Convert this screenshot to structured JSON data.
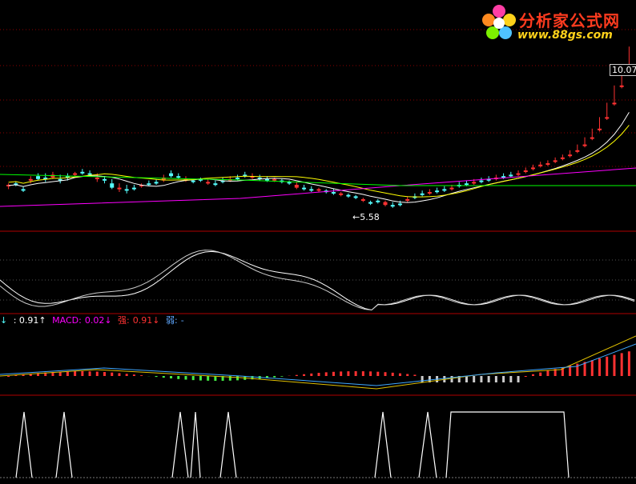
{
  "watermark": {
    "title": "分析家公式网",
    "url": "www.88gs.com"
  },
  "price": {
    "high_label": "10.07",
    "low_label": "5.58"
  },
  "indicator_bar": {
    "item1": "↓",
    "item2": ": 0.91↑",
    "macd_label": "MACD:",
    "macd_value": "0.02↓",
    "strong_label": "强:",
    "strong_value": "0.91↓",
    "weak_label": "弱:",
    "weak_value": "-"
  },
  "colors": {
    "up": "#ff3232",
    "down": "#54fcfc",
    "ma1": "#ffffff",
    "ma2": "#ffff00",
    "ma3": "#ff00ff",
    "ma4": "#00ff00",
    "grid": "#8b0000"
  },
  "chart_data": {
    "type": "candlestick",
    "panels": [
      "price",
      "oscillator",
      "macd",
      "signal"
    ],
    "price_candles": [
      [
        0.5,
        0.6,
        0.4,
        0.2
      ],
      [
        0.6,
        0.7,
        0.5,
        0.4
      ],
      [
        0.2,
        0.4,
        0.1,
        0.0
      ],
      [
        0.9,
        1.1,
        0.8,
        0.6
      ],
      [
        1.1,
        1.3,
        0.9,
        0.8
      ],
      [
        1.0,
        1.3,
        0.9,
        0.7
      ],
      [
        1.2,
        1.4,
        1.0,
        0.9
      ],
      [
        0.9,
        1.2,
        0.8,
        0.6
      ],
      [
        1.1,
        1.3,
        1.0,
        0.8
      ],
      [
        1.3,
        1.4,
        1.2,
        1.1
      ],
      [
        1.4,
        1.6,
        1.3,
        1.2
      ],
      [
        1.3,
        1.5,
        1.2,
        1.1
      ],
      [
        1.0,
        1.3,
        0.9,
        0.7
      ],
      [
        0.9,
        1.1,
        0.8,
        0.6
      ],
      [
        0.6,
        0.9,
        0.3,
        0.2
      ],
      [
        0.3,
        0.6,
        0.2,
        0.0
      ],
      [
        0.2,
        0.5,
        0.1,
        -0.1
      ],
      [
        0.3,
        0.5,
        0.2,
        0.1
      ],
      [
        0.5,
        0.6,
        0.4,
        0.3
      ],
      [
        0.6,
        0.8,
        0.5,
        0.4
      ],
      [
        0.7,
        0.9,
        0.6,
        0.5
      ],
      [
        1.0,
        1.2,
        0.8,
        0.7
      ],
      [
        1.3,
        1.5,
        1.1,
        1.0
      ],
      [
        1.1,
        1.3,
        1.0,
        0.9
      ],
      [
        0.9,
        1.1,
        0.8,
        0.7
      ],
      [
        0.8,
        0.9,
        0.7,
        0.6
      ],
      [
        0.9,
        1.0,
        0.8,
        0.7
      ],
      [
        0.7,
        0.9,
        0.6,
        0.5
      ],
      [
        0.6,
        0.8,
        0.5,
        0.4
      ],
      [
        0.8,
        1.0,
        0.7,
        0.6
      ],
      [
        0.9,
        1.1,
        0.8,
        0.7
      ],
      [
        1.0,
        1.2,
        0.9,
        0.8
      ],
      [
        1.2,
        1.4,
        1.1,
        1.0
      ],
      [
        1.1,
        1.3,
        1.0,
        0.9
      ],
      [
        1.0,
        1.2,
        0.9,
        0.8
      ],
      [
        0.9,
        1.1,
        0.8,
        0.7
      ],
      [
        0.9,
        1.0,
        0.8,
        0.7
      ],
      [
        0.8,
        0.9,
        0.7,
        0.6
      ],
      [
        0.7,
        0.8,
        0.6,
        0.5
      ],
      [
        0.5,
        0.7,
        0.3,
        0.2
      ],
      [
        0.3,
        0.5,
        0.2,
        0.1
      ],
      [
        0.2,
        0.4,
        0.1,
        0.0
      ],
      [
        0.2,
        0.3,
        0.1,
        0.0
      ],
      [
        0.1,
        0.2,
        0.0,
        -0.1
      ],
      [
        0.0,
        0.2,
        -0.1,
        -0.2
      ],
      [
        -0.1,
        0.0,
        -0.2,
        -0.3
      ],
      [
        -0.2,
        -0.1,
        -0.3,
        -0.4
      ],
      [
        -0.3,
        -0.2,
        -0.4,
        -0.5
      ],
      [
        -0.5,
        -0.4,
        -0.6,
        -0.7
      ],
      [
        -0.7,
        -0.6,
        -0.8,
        -0.9
      ],
      [
        -0.6,
        -0.5,
        -0.7,
        -0.8
      ],
      [
        -0.7,
        -0.6,
        -0.9,
        -1.0
      ],
      [
        -0.9,
        -0.7,
        -1.0,
        -1.1
      ],
      [
        -0.8,
        -0.6,
        -0.9,
        -1.0
      ],
      [
        -0.5,
        -0.3,
        -0.6,
        -0.7
      ],
      [
        -0.3,
        -0.1,
        -0.4,
        -0.5
      ],
      [
        -0.1,
        0.1,
        -0.2,
        -0.3
      ],
      [
        0.0,
        0.2,
        -0.1,
        -0.2
      ],
      [
        0.1,
        0.3,
        0.0,
        -0.1
      ],
      [
        0.2,
        0.4,
        0.1,
        0.0
      ],
      [
        0.3,
        0.5,
        0.2,
        0.1
      ],
      [
        0.5,
        0.7,
        0.4,
        0.3
      ],
      [
        0.6,
        0.8,
        0.5,
        0.4
      ],
      [
        0.7,
        0.9,
        0.6,
        0.5
      ],
      [
        0.8,
        1.0,
        0.7,
        0.6
      ],
      [
        0.9,
        1.1,
        0.8,
        0.7
      ],
      [
        1.0,
        1.2,
        0.9,
        0.8
      ],
      [
        1.1,
        1.3,
        1.0,
        0.9
      ],
      [
        1.2,
        1.4,
        1.1,
        1.0
      ],
      [
        1.3,
        1.5,
        1.2,
        1.1
      ],
      [
        1.5,
        1.7,
        1.4,
        1.3
      ],
      [
        1.7,
        1.9,
        1.6,
        1.5
      ],
      [
        1.9,
        2.1,
        1.8,
        1.7
      ],
      [
        2.0,
        2.2,
        1.9,
        1.8
      ],
      [
        2.2,
        2.4,
        2.1,
        2.0
      ],
      [
        2.4,
        2.6,
        2.3,
        2.2
      ],
      [
        2.6,
        2.9,
        2.5,
        2.4
      ],
      [
        2.9,
        3.3,
        2.8,
        2.7
      ],
      [
        3.3,
        3.8,
        3.2,
        3.1
      ],
      [
        3.8,
        4.4,
        3.7,
        3.6
      ],
      [
        4.4,
        5.2,
        4.3,
        4.2
      ],
      [
        5.2,
        6.2,
        5.1,
        5.0
      ],
      [
        6.2,
        7.4,
        6.1,
        6.0
      ],
      [
        7.4,
        8.8,
        7.3,
        7.2
      ],
      [
        8.8,
        10.1,
        8.7,
        8.6
      ]
    ]
  }
}
